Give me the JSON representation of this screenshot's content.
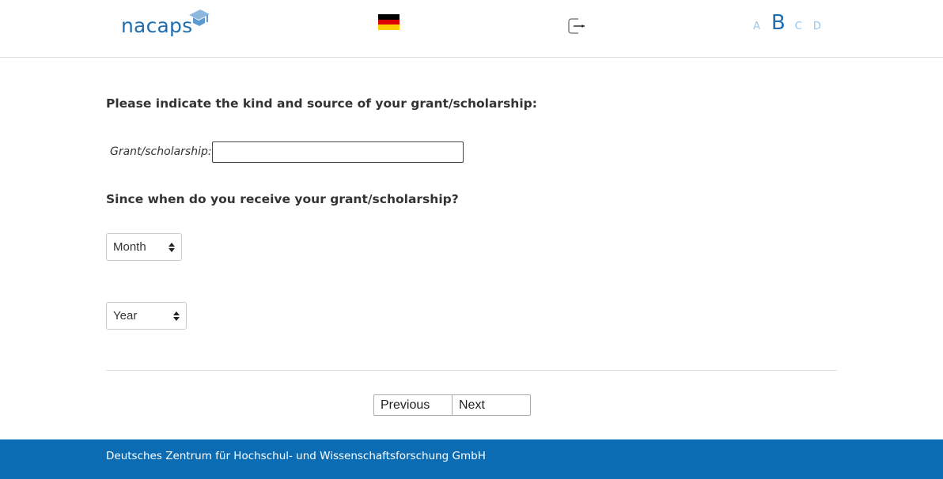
{
  "header": {
    "logo_text": "nacaps",
    "logo_icon": "graduation-cap-icon",
    "flag_icon": "german-flag-icon",
    "flag_colors": [
      "#000000",
      "#dd0000",
      "#ffce00"
    ],
    "exit_icon": "exit-icon",
    "font_sizes": [
      "A",
      "B",
      "C",
      "D"
    ],
    "selected_font_size": "B"
  },
  "colors": {
    "brand": "#1f6fb0",
    "brand_light": "#9cc6e6",
    "footer_bg": "#0c6cb3"
  },
  "form": {
    "question1": "Please indicate the kind and source of your grant/scholarship:",
    "grant_label": "Grant/scholarship:",
    "grant_value": "",
    "question2": "Since when do you receive your grant/scholarship?",
    "month_selected": "Month",
    "year_selected": "Year"
  },
  "nav": {
    "previous_label": "Previous",
    "next_label": "Next"
  },
  "footer": {
    "text": "Deutsches Zentrum für Hochschul- und Wissenschaftsforschung GmbH"
  }
}
